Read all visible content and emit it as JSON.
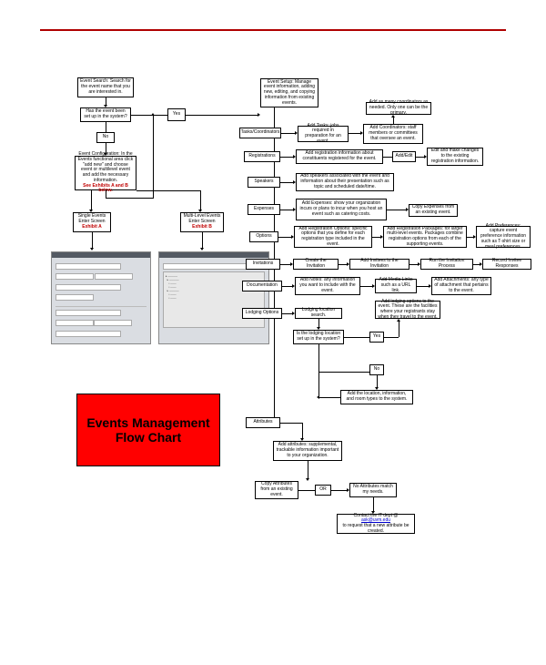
{
  "header_rule": true,
  "banner": {
    "line1": "Events Management",
    "line2": "Flow Chart"
  },
  "nodes": {
    "event_search": "Event Search: Search for the event name that you are interested in.",
    "has_event": "Has the event been set up in the system?",
    "yes1": "Yes",
    "no1": "No",
    "event_config": "Event Configuration: In the Events functional area click \"add new\" and choose event or multilevel event and add the necessary information.",
    "config_see": "See Exhibits A and B below.",
    "single_events": "Single Events Enter Screen",
    "exhibit_a": "Exhibit A",
    "multi_events": "Multi-Level Events Enter Screen",
    "exhibit_b": "Exhibit B",
    "event_setup": "Event Setup: Manage event information, adding new, editing, and copying information from existing events.",
    "tasks_coord": "Tasks/Coordinators",
    "add_tasks": "Add Tasks: jobs required in preparation for an event.",
    "add_coord": "Add Coordinators: staff members or committees that oversee an event.",
    "add_contrib": "Add as many coordinators as needed. Only one can be the primary.",
    "registrations": "Registrations",
    "add_reg": "Add registration information about constituents registered for the event.",
    "add_edit": "Add/Edit",
    "edit_changes": "Edit and make changes to the existing registration information.",
    "speakers": "Speakers",
    "add_speakers": "Add speakers associated with the event and information about their presentation such as topic and scheduled date/time.",
    "expenses": "Expenses",
    "add_expenses": "Add Expenses: show your organization incurs or plans to incur when you host an event such as catering costs.",
    "copy_expenses": "Copy Expenses from an existing event.",
    "options": "Options",
    "add_reg_options": "Add Registration Options: specific options that you define for each registration type included in the event.",
    "add_reg_packages": "Add Registration Packages: for larger multi-level events. Packages combine registration options from each of the supporting events.",
    "add_preferences": "Add Preferences: capture event preference information such as T-shirt size or meal preferences.",
    "invitations": "Invitations",
    "create_inv": "Create the Invitation",
    "add_invitees": "Add Invitees to the Invitation",
    "run_process": "Run the Invitation Process",
    "record_responses": "Record Invitee Responses",
    "documentation": "Documentation",
    "add_notes": "Add Notes: any information you want to include with the event.",
    "add_media": "Add Media Links such as a URL link.",
    "add_attach": "Add Attachments: any type of attachment that pertains to the event.",
    "lodging": "Lodging Options",
    "lodging_search": "Lodging location search.",
    "lodging_q": "Is the lodging location set up in the system?",
    "yes2": "Yes",
    "no2": "No",
    "add_lodging": "Add lodging options to the event. These are the facilities where your registrants stay when they travel to the event.",
    "add_location": "Add the location, information, and room types to the system.",
    "attributes": "Attributes",
    "add_attributes": "Add attributes: supplemental, trackable information important to your organization.",
    "copy_attr": "Copy Attributes from an existing event.",
    "or": "OR",
    "no_match": "No Attributes match my needs.",
    "contact_it": "Contact the IT dept @",
    "contact_email": "ask@uvm.edu",
    "contact_rest": "to request that a new attribute be created."
  }
}
